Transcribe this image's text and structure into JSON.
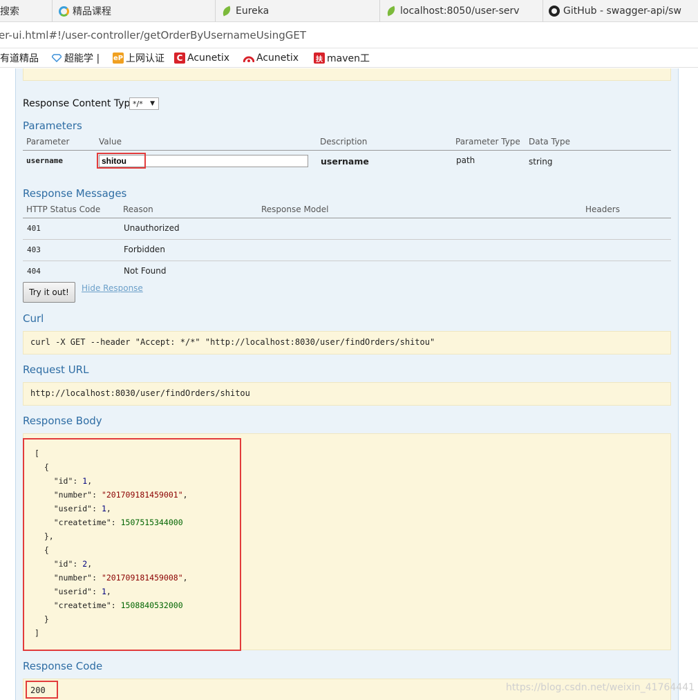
{
  "tabs": [
    {
      "label": "搜索",
      "icon": "search"
    },
    {
      "label": "精品课程",
      "icon": "spinner-icon"
    },
    {
      "label": "Eureka",
      "icon": "leaf-icon"
    },
    {
      "label": "localhost:8050/user-serv",
      "icon": "leaf-icon"
    },
    {
      "label": "GitHub - swagger-api/sw",
      "icon": "github-icon"
    }
  ],
  "address_bar": {
    "url": "er-ui.html#!/user-controller/getOrderByUsernameUsingGET"
  },
  "bookmarks": [
    {
      "label": "有道精品"
    },
    {
      "label": "超能学 |"
    },
    {
      "label": "上网认证",
      "badge": "eP"
    },
    {
      "label": "Acunetix",
      "badge": "C"
    },
    {
      "label": "Acunetix"
    },
    {
      "label": "maven工",
      "badge": "扶"
    }
  ],
  "response_content_type": {
    "label": "Response Content Type",
    "value": "*/*"
  },
  "parameters": {
    "title": "Parameters",
    "headers": [
      "Parameter",
      "Value",
      "Description",
      "Parameter Type",
      "Data Type"
    ],
    "rows": [
      {
        "parameter": "username",
        "value": "shitou",
        "description": "username",
        "param_type": "path",
        "data_type": "string"
      }
    ]
  },
  "response_messages": {
    "title": "Response Messages",
    "headers": [
      "HTTP Status Code",
      "Reason",
      "Response Model",
      "Headers"
    ],
    "rows": [
      {
        "code": "401",
        "reason": "Unauthorized"
      },
      {
        "code": "403",
        "reason": "Forbidden"
      },
      {
        "code": "404",
        "reason": "Not Found"
      }
    ]
  },
  "actions": {
    "try_label": "Try it out!",
    "hide_label": "Hide Response"
  },
  "curl": {
    "title": "Curl",
    "command": "curl -X GET --header \"Accept: */*\" \"http://localhost:8030/user/findOrders/shitou\""
  },
  "request_url": {
    "title": "Request URL",
    "url": "http://localhost:8030/user/findOrders/shitou"
  },
  "response_body": {
    "title": "Response Body",
    "orders": [
      {
        "id": "1",
        "number": "\"201709181459001\"",
        "userid": "1",
        "createtime": "1507515344000"
      },
      {
        "id": "2",
        "number": "\"201709181459008\"",
        "userid": "1",
        "createtime": "1508840532000"
      }
    ]
  },
  "response_code": {
    "title": "Response Code",
    "value": "200"
  },
  "watermark": "https://blog.csdn.net/weixin_41764441"
}
